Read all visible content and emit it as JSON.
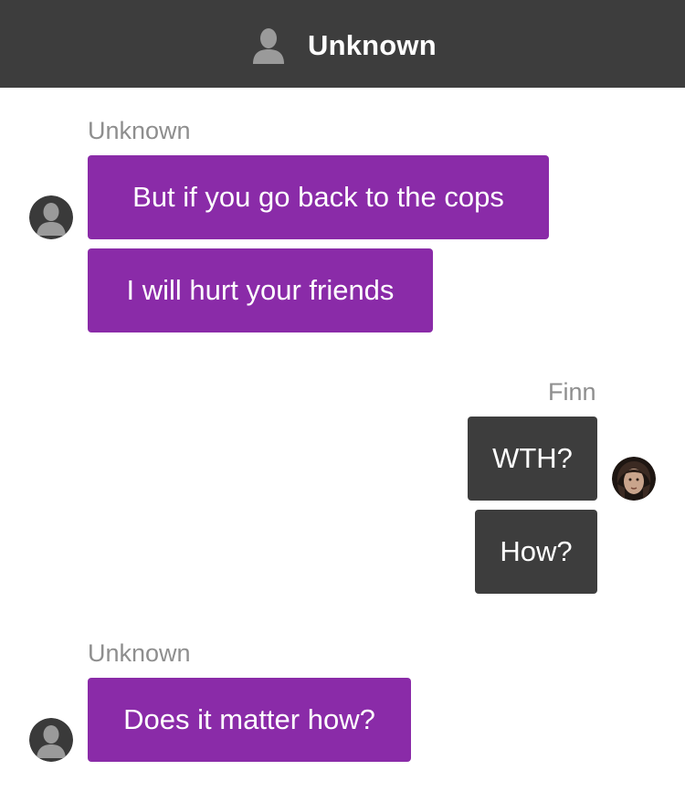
{
  "header": {
    "title": "Unknown",
    "icon": "contact-person-icon",
    "background": "#3d3d3d"
  },
  "conversation": {
    "group1": {
      "sender": "Unknown",
      "messages": [
        "But if you go back to the cops",
        "I will hurt your friends"
      ],
      "avatar_icon": "default-person-avatar"
    },
    "group2": {
      "sender": "Finn",
      "messages": [
        "WTH?",
        "How?"
      ],
      "avatar_icon": "finn-photo-avatar"
    },
    "group3": {
      "sender": "Unknown",
      "messages": [
        "Does it matter how?"
      ],
      "avatar_icon": "default-person-avatar"
    }
  },
  "colors": {
    "incoming_bubble": "#8a2ba8",
    "outgoing_bubble": "#3d3d3d",
    "sender_label": "#8e8e8e"
  }
}
